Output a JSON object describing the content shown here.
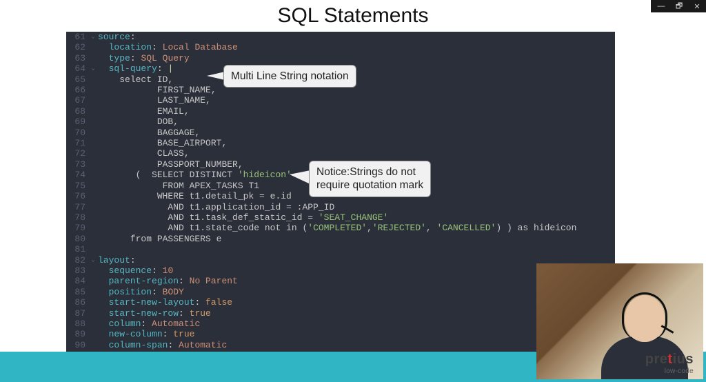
{
  "window": {
    "min": "—",
    "max": "🗗",
    "close": "✕"
  },
  "slide": {
    "title": "SQL Statements"
  },
  "callouts": {
    "c1": "Multi Line String notation",
    "c2": "Notice:Strings do not\nrequire quotation mark"
  },
  "logo": {
    "brand_pre": "pre",
    "brand_t": "t",
    "brand_post": "ius",
    "sub": "low-code"
  },
  "code": [
    {
      "n": 61,
      "fold": "v",
      "segs": [
        [
          "k-key",
          "source"
        ],
        [
          "",
          ":"
        ]
      ]
    },
    {
      "n": 62,
      "fold": "",
      "segs": [
        [
          "",
          "  "
        ],
        [
          "k-key",
          "location"
        ],
        [
          "",
          ": "
        ],
        [
          "k-val",
          "Local Database"
        ]
      ]
    },
    {
      "n": 63,
      "fold": "",
      "segs": [
        [
          "",
          "  "
        ],
        [
          "k-key",
          "type"
        ],
        [
          "",
          ": "
        ],
        [
          "k-val",
          "SQL Query"
        ]
      ]
    },
    {
      "n": 64,
      "fold": "v",
      "segs": [
        [
          "",
          "  "
        ],
        [
          "k-key",
          "sql-query"
        ],
        [
          "",
          ": "
        ],
        [
          "k-pipe",
          "|"
        ]
      ]
    },
    {
      "n": 65,
      "fold": "",
      "segs": [
        [
          "",
          "    "
        ],
        [
          "k-sql",
          "select ID,"
        ]
      ]
    },
    {
      "n": 66,
      "fold": "",
      "segs": [
        [
          "",
          "           "
        ],
        [
          "k-sql",
          "FIRST_NAME,"
        ]
      ]
    },
    {
      "n": 67,
      "fold": "",
      "segs": [
        [
          "",
          "           "
        ],
        [
          "k-sql",
          "LAST_NAME,"
        ]
      ]
    },
    {
      "n": 68,
      "fold": "",
      "segs": [
        [
          "",
          "           "
        ],
        [
          "k-sql",
          "EMAIL,"
        ]
      ]
    },
    {
      "n": 69,
      "fold": "",
      "segs": [
        [
          "",
          "           "
        ],
        [
          "k-sql",
          "DOB,"
        ]
      ]
    },
    {
      "n": 70,
      "fold": "",
      "segs": [
        [
          "",
          "           "
        ],
        [
          "k-sql",
          "BAGGAGE,"
        ]
      ]
    },
    {
      "n": 71,
      "fold": "",
      "segs": [
        [
          "",
          "           "
        ],
        [
          "k-sql",
          "BASE_AIRPORT,"
        ]
      ]
    },
    {
      "n": 72,
      "fold": "",
      "segs": [
        [
          "",
          "           "
        ],
        [
          "k-sql",
          "CLASS,"
        ]
      ]
    },
    {
      "n": 73,
      "fold": "",
      "segs": [
        [
          "",
          "           "
        ],
        [
          "k-sql",
          "PASSPORT_NUMBER,"
        ]
      ]
    },
    {
      "n": 74,
      "fold": "",
      "segs": [
        [
          "",
          "       "
        ],
        [
          "k-sql",
          "(  SELECT DISTINCT "
        ],
        [
          "k-str",
          "'hideicon'"
        ]
      ]
    },
    {
      "n": 75,
      "fold": "",
      "segs": [
        [
          "",
          "            "
        ],
        [
          "k-sql",
          "FROM APEX_TASKS T1"
        ]
      ]
    },
    {
      "n": 76,
      "fold": "",
      "segs": [
        [
          "",
          "           "
        ],
        [
          "k-sql",
          "WHERE t1.detail_pk = e.id"
        ]
      ]
    },
    {
      "n": 77,
      "fold": "",
      "segs": [
        [
          "",
          "             "
        ],
        [
          "k-sql",
          "AND t1.application_id = :APP_ID"
        ]
      ]
    },
    {
      "n": 78,
      "fold": "",
      "segs": [
        [
          "",
          "             "
        ],
        [
          "k-sql",
          "AND t1.task_def_static_id = "
        ],
        [
          "k-str",
          "'SEAT_CHANGE'"
        ]
      ]
    },
    {
      "n": 79,
      "fold": "",
      "segs": [
        [
          "",
          "             "
        ],
        [
          "k-sql",
          "AND t1.state_code not in ("
        ],
        [
          "k-str",
          "'COMPLETED'"
        ],
        [
          "k-sql",
          ","
        ],
        [
          "k-str",
          "'REJECTED'"
        ],
        [
          "k-sql",
          ", "
        ],
        [
          "k-str",
          "'CANCELLED'"
        ],
        [
          "k-sql",
          ") ) as hideicon"
        ]
      ]
    },
    {
      "n": 80,
      "fold": "",
      "segs": [
        [
          "",
          "      "
        ],
        [
          "k-sql",
          "from PASSENGERS e"
        ]
      ]
    },
    {
      "n": 81,
      "fold": "",
      "segs": [
        [
          "",
          ""
        ]
      ]
    },
    {
      "n": 82,
      "fold": "v",
      "segs": [
        [
          "k-key",
          "layout"
        ],
        [
          "",
          ":"
        ]
      ]
    },
    {
      "n": 83,
      "fold": "",
      "segs": [
        [
          "",
          "  "
        ],
        [
          "k-key",
          "sequence"
        ],
        [
          "",
          ": "
        ],
        [
          "k-val",
          "10"
        ]
      ]
    },
    {
      "n": 84,
      "fold": "",
      "segs": [
        [
          "",
          "  "
        ],
        [
          "k-key",
          "parent-region"
        ],
        [
          "",
          ": "
        ],
        [
          "k-val",
          "No Parent"
        ]
      ]
    },
    {
      "n": 85,
      "fold": "",
      "segs": [
        [
          "",
          "  "
        ],
        [
          "k-key",
          "position"
        ],
        [
          "",
          ": "
        ],
        [
          "k-val",
          "BODY"
        ]
      ]
    },
    {
      "n": 86,
      "fold": "",
      "segs": [
        [
          "",
          "  "
        ],
        [
          "k-key",
          "start-new-layout"
        ],
        [
          "",
          ": "
        ],
        [
          "k-bool",
          "false"
        ]
      ]
    },
    {
      "n": 87,
      "fold": "",
      "segs": [
        [
          "",
          "  "
        ],
        [
          "k-key",
          "start-new-row"
        ],
        [
          "",
          ": "
        ],
        [
          "k-bool",
          "true"
        ]
      ]
    },
    {
      "n": 88,
      "fold": "",
      "segs": [
        [
          "",
          "  "
        ],
        [
          "k-key",
          "column"
        ],
        [
          "",
          ": "
        ],
        [
          "k-val",
          "Automatic"
        ]
      ]
    },
    {
      "n": 89,
      "fold": "",
      "segs": [
        [
          "",
          "  "
        ],
        [
          "k-key",
          "new-column"
        ],
        [
          "",
          ": "
        ],
        [
          "k-bool",
          "true"
        ]
      ]
    },
    {
      "n": 90,
      "fold": "",
      "segs": [
        [
          "",
          "  "
        ],
        [
          "k-key",
          "column-span"
        ],
        [
          "",
          ": "
        ],
        [
          "k-val",
          "Automatic"
        ]
      ]
    }
  ]
}
